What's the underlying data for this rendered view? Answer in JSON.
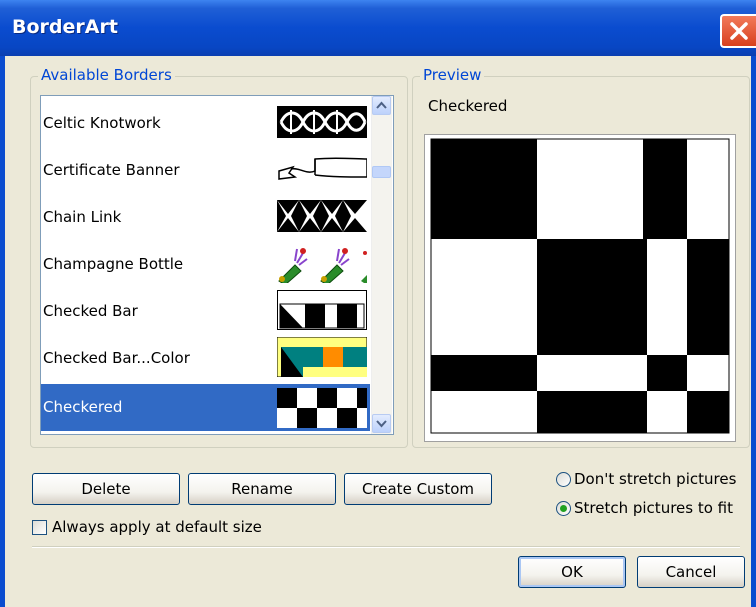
{
  "window": {
    "title": "BorderArt",
    "close_icon": "close-x-icon"
  },
  "available_borders": {
    "label": "Available Borders",
    "items": [
      {
        "label": "Celtic Knotwork",
        "thumbnail": "celtic-knot-thumbnail"
      },
      {
        "label": "Certificate Banner",
        "thumbnail": "banner-thumbnail"
      },
      {
        "label": "Chain Link",
        "thumbnail": "chain-link-thumbnail"
      },
      {
        "label": "Champagne Bottle",
        "thumbnail": "champagne-bottle-thumbnail"
      },
      {
        "label": "Checked Bar",
        "thumbnail": "checked-bar-thumbnail"
      },
      {
        "label": "Checked Bar...Color",
        "thumbnail": "checked-bar-color-thumbnail"
      },
      {
        "label": "Checkered",
        "thumbnail": "checkered-thumbnail",
        "selected": true
      }
    ],
    "selected_color": "#316ac5"
  },
  "preview": {
    "label": "Preview",
    "name": "Checkered"
  },
  "buttons": {
    "delete": "Delete",
    "rename": "Rename",
    "create_custom": "Create Custom",
    "ok": "OK",
    "cancel": "Cancel"
  },
  "options": {
    "always_apply": {
      "label": "Always apply at default size",
      "checked": false
    },
    "dont_stretch": {
      "label": "Don't stretch pictures",
      "selected": false
    },
    "stretch_fit": {
      "label": "Stretch pictures to fit",
      "selected": true
    }
  },
  "colors": {
    "titlebar": "#0a4ccf",
    "dialog_bg": "#ece9d8",
    "group_label": "#0046d5",
    "radio_dot": "#21a121"
  }
}
